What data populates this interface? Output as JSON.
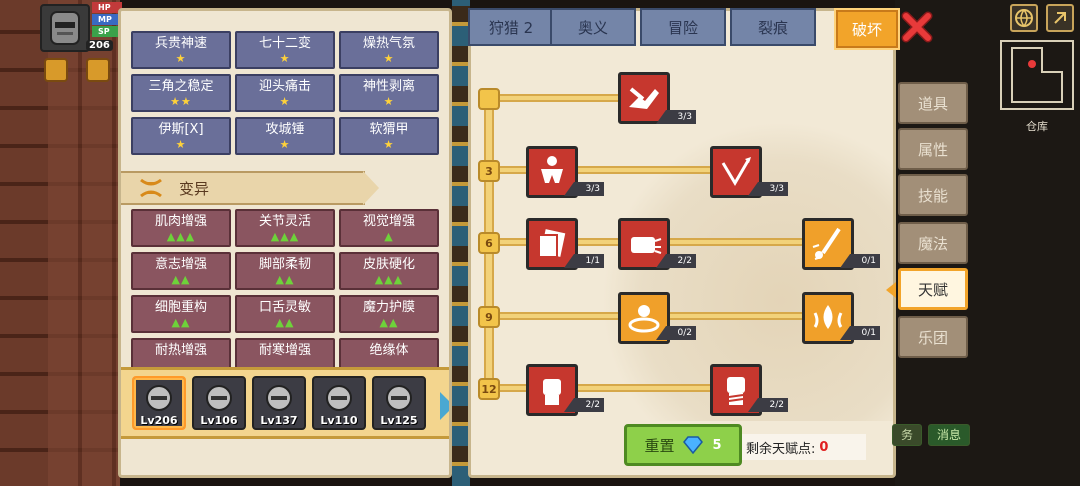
{
  "hud": {
    "hp_label": "HP",
    "mp_label": "MP",
    "sp_label": "SP",
    "level": "206"
  },
  "attributes_top": [
    {
      "name": "兵贵神速",
      "stars": "★"
    },
    {
      "name": "七十二变",
      "stars": "★"
    },
    {
      "name": "燥热气氛",
      "stars": "★"
    },
    {
      "name": "三角之稳定",
      "stars": "★★"
    },
    {
      "name": "迎头痛击",
      "stars": "★"
    },
    {
      "name": "神性剥离",
      "stars": "★"
    },
    {
      "name": "伊斯[X]",
      "stars": "★"
    },
    {
      "name": "攻城锤",
      "stars": "★"
    },
    {
      "name": "软猬甲",
      "stars": "★"
    }
  ],
  "mutation_section": {
    "label": "变异",
    "items": [
      {
        "name": "肌肉增强",
        "marks": "▲▲▲"
      },
      {
        "name": "关节灵活",
        "marks": "▲▲▲"
      },
      {
        "name": "视觉增强",
        "marks": "▲"
      },
      {
        "name": "意志增强",
        "marks": "▲▲"
      },
      {
        "name": "脚部柔韧",
        "marks": "▲▲"
      },
      {
        "name": "皮肤硬化",
        "marks": "▲▲▲"
      },
      {
        "name": "细胞重构",
        "marks": "▲▲"
      },
      {
        "name": "口舌灵敏",
        "marks": "▲▲"
      },
      {
        "name": "魔力护膜",
        "marks": "▲▲"
      },
      {
        "name": "耐热增强",
        "marks": ""
      },
      {
        "name": "耐寒增强",
        "marks": ""
      },
      {
        "name": "绝缘体",
        "marks": ""
      }
    ]
  },
  "characters": [
    {
      "level": "Lv206"
    },
    {
      "level": "Lv106"
    },
    {
      "level": "Lv137"
    },
    {
      "level": "Lv110"
    },
    {
      "level": "Lv125"
    }
  ],
  "tabs": [
    {
      "label": "狩猎 2"
    },
    {
      "label": "奥义"
    },
    {
      "label": "冒险"
    },
    {
      "label": "裂痕"
    },
    {
      "label": "破坏"
    }
  ],
  "talent_levels": [
    "3",
    "6",
    "9",
    "12"
  ],
  "skills": [
    {
      "icon": "arm-wrestle-icon",
      "count": "3/3"
    },
    {
      "icon": "muscle-body-icon",
      "count": "3/3"
    },
    {
      "icon": "arrow-strike-icon",
      "count": "3/3"
    },
    {
      "icon": "card-icon",
      "count": "1/1"
    },
    {
      "icon": "punch-icon",
      "count": "2/2"
    },
    {
      "icon": "blade-flash-icon",
      "count": "0/1"
    },
    {
      "icon": "ground-ring-icon",
      "count": "0/2"
    },
    {
      "icon": "fire-drop-icon",
      "count": "0/1"
    },
    {
      "icon": "fist-icon",
      "count": "2/2"
    },
    {
      "icon": "wrapped-fist-icon",
      "count": "2/2"
    }
  ],
  "reset": {
    "label": "重置",
    "cost": "5"
  },
  "remaining_points": {
    "label": "剩余天赋点:",
    "value": "0"
  },
  "side_menu": [
    {
      "label": "道具"
    },
    {
      "label": "属性"
    },
    {
      "label": "技能"
    },
    {
      "label": "魔法"
    },
    {
      "label": "天赋"
    },
    {
      "label": "乐团"
    }
  ],
  "right_hud": {
    "warehouse": "仓库",
    "message": "消息",
    "task": "务"
  },
  "colors": {
    "tab_active": "#f2a42a",
    "skill_red": "#c6372e",
    "skill_gold": "#f0a02a",
    "reset_green": "#8ed04a",
    "remaining_zero": "#e02020"
  }
}
